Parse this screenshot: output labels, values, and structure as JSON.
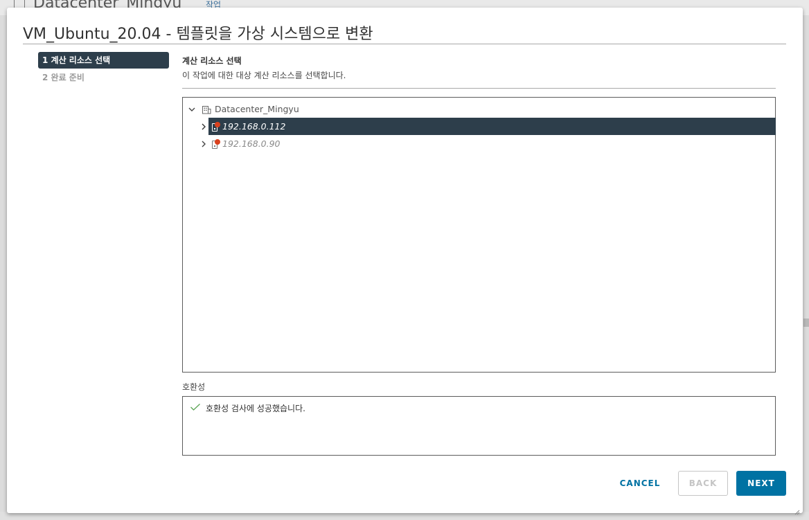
{
  "background": {
    "title": "Datacenter_Mingyu",
    "action_label": "작업"
  },
  "modal": {
    "title": "VM_Ubuntu_20.04 - 템플릿을 가상 시스템으로 변환",
    "steps": [
      {
        "label": "1 계산 리소스 선택",
        "state": "active"
      },
      {
        "label": "2 완료 준비",
        "state": "inactive"
      }
    ],
    "section": {
      "title": "계산 리소스 선택",
      "description": "이 작업에 대한 대상 계산 리소스를 선택합니다."
    },
    "tree": {
      "datacenter": {
        "label": "Datacenter_Mingyu",
        "icon": "datacenter-icon",
        "expanded": true
      },
      "hosts": [
        {
          "label": "192.168.0.112",
          "icon": "host-icon",
          "alert": true,
          "selected": true
        },
        {
          "label": "192.168.0.90",
          "icon": "host-icon",
          "alert": true,
          "selected": false
        }
      ]
    },
    "compatibility": {
      "label": "호환성",
      "message": "호환성 검사에 성공했습니다.",
      "status_color": "#4caf50"
    },
    "buttons": {
      "cancel": "CANCEL",
      "back": "BACK",
      "next": "NEXT"
    },
    "colors": {
      "accent": "#0072a3",
      "selected_bg": "#2d3e4b",
      "alert": "#d9411e"
    }
  }
}
